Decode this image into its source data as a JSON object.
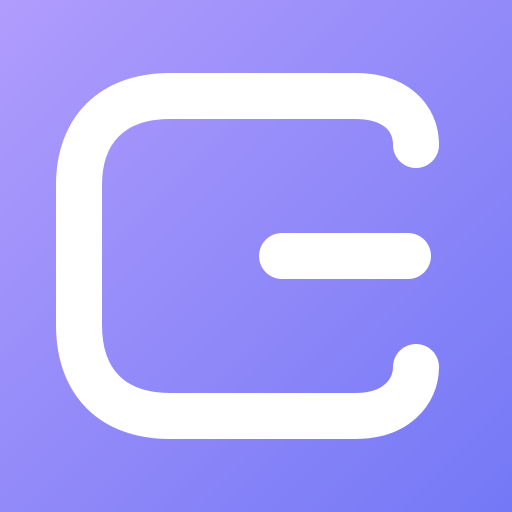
{
  "app_icon": {
    "icon": "wallet-icon",
    "colors": {
      "gradient_start": "#B09CFC",
      "gradient_end": "#7478F6",
      "glyph": "#FFFFFF"
    }
  }
}
